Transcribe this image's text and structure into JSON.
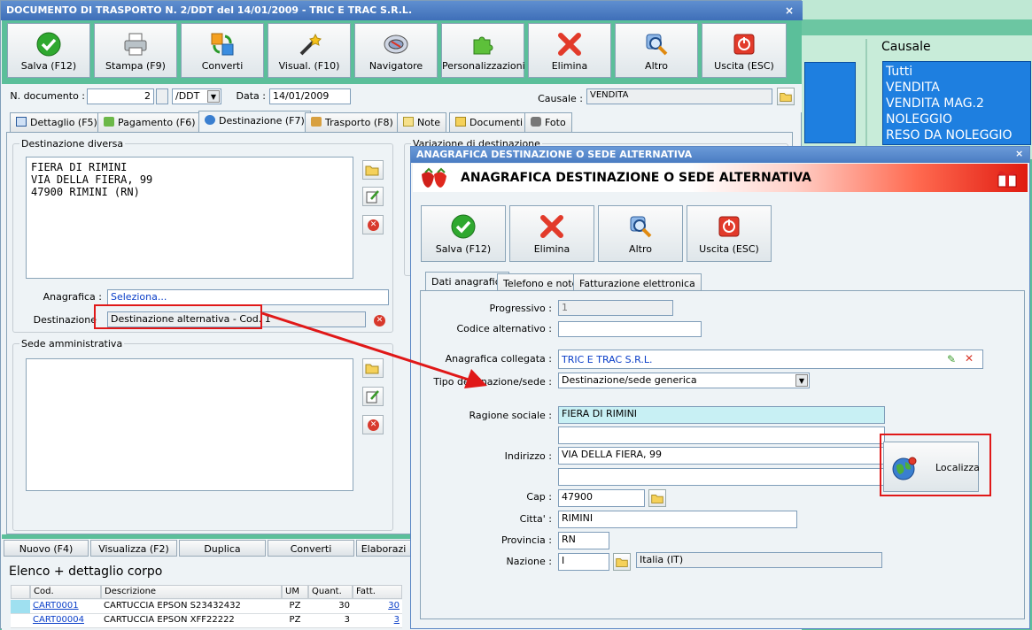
{
  "background_window": {
    "causale_title": "Causale",
    "causale_items": [
      "Tutti",
      "VENDITA",
      "VENDITA MAG.2",
      "NOLEGGIO",
      "RESO DA NOLEGGIO"
    ]
  },
  "main_window": {
    "title": "DOCUMENTO DI TRASPORTO N. 2/DDT del 14/01/2009 - TRIC E TRAC S.R.L.",
    "close": "×",
    "toolbar": [
      {
        "label": "Salva (F12)",
        "icon": "check-icon"
      },
      {
        "label": "Stampa (F9)",
        "icon": "printer-icon"
      },
      {
        "label": "Converti",
        "icon": "convert-icon"
      },
      {
        "label": "Visual. (F10)",
        "icon": "magic-wand-icon"
      },
      {
        "label": "Navigatore",
        "icon": "navigator-icon"
      },
      {
        "label": "Personalizzazioni",
        "icon": "puzzle-icon"
      },
      {
        "label": "Elimina",
        "icon": "delete-icon"
      },
      {
        "label": "Altro",
        "icon": "search-icon"
      },
      {
        "label": "Uscita (ESC)",
        "icon": "exit-icon"
      }
    ],
    "form": {
      "doc_number_label": "N. documento :",
      "doc_number": "2",
      "doc_series": "/DDT",
      "date_label": "Data :",
      "date": "14/01/2009",
      "causale_label": "Causale :",
      "causale": "VENDITA"
    },
    "tabs": [
      "Dettaglio (F5)",
      "Pagamento (F6)",
      "Destinazione (F7)",
      "Trasporto (F8)",
      "Note",
      "Documenti",
      "Foto"
    ],
    "destination": {
      "group_title": "Destinazione diversa",
      "address_lines": [
        "FIERA DI RIMINI",
        "VIA DELLA FIERA, 99",
        "47900 RIMINI (RN)"
      ],
      "anagrafica_label": "Anagrafica :",
      "anagrafica_value": "Seleziona...",
      "destinazione_label": "Destinazione",
      "destinazione_value": "Destinazione alternativa - Cod. 1",
      "variation_title": "Variazione di destinazione"
    },
    "sede": {
      "group_title": "Sede amministrativa"
    },
    "bottom_buttons": [
      "Nuovo (F4)",
      "Visualizza (F2)",
      "Duplica",
      "Converti",
      "Elaborazi"
    ],
    "list": {
      "title": "Elenco + dettaglio corpo",
      "columns": [
        "Cod.",
        "Descrizione",
        "UM",
        "Quant.",
        "Fatt."
      ],
      "rows": [
        {
          "code": "CART0001",
          "desc": "CARTUCCIA EPSON S23432432",
          "um": "PZ",
          "qty": "30",
          "fatt": "30"
        },
        {
          "code": "CART00004",
          "desc": "CARTUCCIA EPSON XFF22222",
          "um": "PZ",
          "qty": "3",
          "fatt": "3"
        }
      ]
    }
  },
  "dialog": {
    "title": "ANAGRAFICA DESTINAZIONE O SEDE ALTERNATIVA",
    "header": "ANAGRAFICA DESTINAZIONE O SEDE ALTERNATIVA",
    "close": "×",
    "buttons": [
      {
        "label": "Salva (F12)",
        "icon": "check-icon"
      },
      {
        "label": "Elimina",
        "icon": "delete-icon"
      },
      {
        "label": "Altro",
        "icon": "search-icon"
      },
      {
        "label": "Uscita (ESC)",
        "icon": "exit-icon"
      }
    ],
    "tabs": [
      "Dati anagrafici",
      "Telefono e note",
      "Fatturazione elettronica"
    ],
    "fields": {
      "progressivo_label": "Progressivo :",
      "progressivo": "1",
      "codice_alt_label": "Codice alternativo :",
      "codice_alt": "",
      "anagrafica_label": "Anagrafica collegata :",
      "anagrafica": "TRIC E TRAC S.R.L.",
      "tipo_label": "Tipo destinazione/sede :",
      "tipo": "Destinazione/sede generica",
      "ragione_label": "Ragione sociale :",
      "ragione": "FIERA DI RIMINI",
      "ragione2": "",
      "indirizzo_label": "Indirizzo :",
      "indirizzo": "VIA DELLA FIERA, 99",
      "indirizzo2": "",
      "cap_label": "Cap :",
      "cap": "47900",
      "citta_label": "Citta' :",
      "citta": "RIMINI",
      "provincia_label": "Provincia :",
      "provincia": "RN",
      "nazione_label": "Nazione :",
      "nazione_code": "I",
      "nazione_name": "Italia (IT)"
    },
    "localizza_label": "Localizza"
  },
  "colors": {
    "accent_green": "#5bbf9a",
    "title_blue": "#3f6fb8",
    "highlight_red": "#e01818",
    "list_blue": "#1e7fe0"
  }
}
